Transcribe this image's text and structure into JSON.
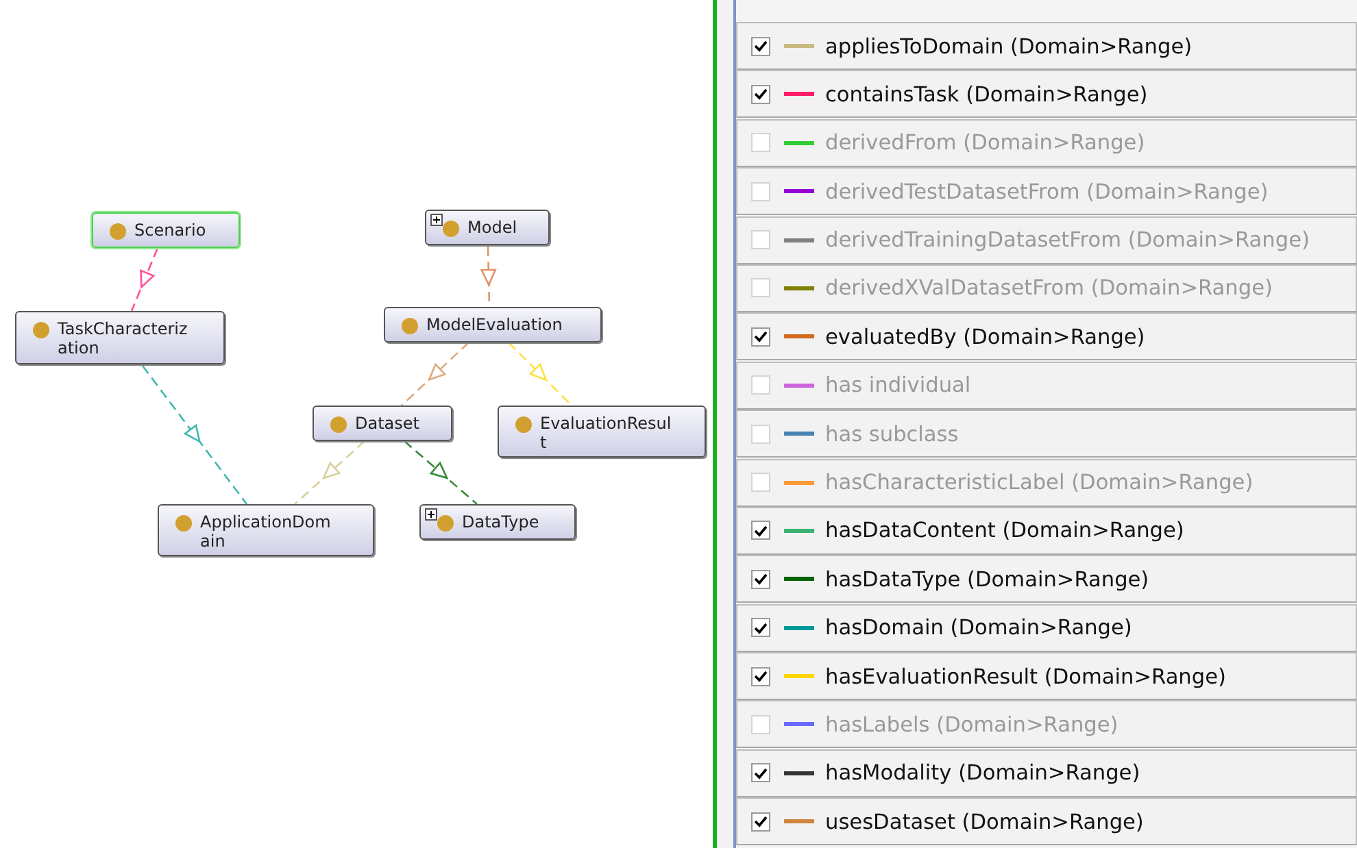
{
  "diagram": {
    "nodes": [
      {
        "label": "Scenario",
        "expandable": false,
        "selected": true
      },
      {
        "label": "TaskCharacterization",
        "expandable": false,
        "selected": false
      },
      {
        "label": "Model",
        "expandable": true,
        "selected": false
      },
      {
        "label": "ModelEvaluation",
        "expandable": false,
        "selected": false
      },
      {
        "label": "Dataset",
        "expandable": false,
        "selected": false
      },
      {
        "label": "EvaluationResult",
        "expandable": false,
        "selected": false
      },
      {
        "label": "ApplicationDomain",
        "expandable": false,
        "selected": false
      },
      {
        "label": "DataType",
        "expandable": true,
        "selected": false
      }
    ],
    "edges": [
      {
        "color": "#ff4f9a"
      },
      {
        "color": "#3fb7b0"
      },
      {
        "color": "#e0956a"
      },
      {
        "color": "#dcaa80"
      },
      {
        "color": "#ffe040"
      },
      {
        "color": "#d8d09a"
      },
      {
        "color": "#3a8a3a"
      }
    ]
  },
  "properties": [
    {
      "label": "appliesToDomain (Domain>Range)",
      "checked": true,
      "color": "#c8ba80"
    },
    {
      "label": "containsTask (Domain>Range)",
      "checked": true,
      "color": "#ff1a6a"
    },
    {
      "label": "derivedFrom (Domain>Range)",
      "checked": false,
      "color": "#33cc33"
    },
    {
      "label": "derivedTestDatasetFrom (Domain>Range)",
      "checked": false,
      "color": "#9400d3"
    },
    {
      "label": "derivedTrainingDatasetFrom (Domain>Range)",
      "checked": false,
      "color": "#808080"
    },
    {
      "label": "derivedXValDatasetFrom (Domain>Range)",
      "checked": false,
      "color": "#808000"
    },
    {
      "label": "evaluatedBy (Domain>Range)",
      "checked": true,
      "color": "#d2691e"
    },
    {
      "label": "has individual",
      "checked": false,
      "color": "#cc66dd"
    },
    {
      "label": "has subclass",
      "checked": false,
      "color": "#4682b4"
    },
    {
      "label": "hasCharacteristicLabel (Domain>Range)",
      "checked": false,
      "color": "#ff9933"
    },
    {
      "label": "hasDataContent (Domain>Range)",
      "checked": true,
      "color": "#3cb371"
    },
    {
      "label": "hasDataType (Domain>Range)",
      "checked": true,
      "color": "#006400"
    },
    {
      "label": "hasDomain (Domain>Range)",
      "checked": true,
      "color": "#009999"
    },
    {
      "label": "hasEvaluationResult (Domain>Range)",
      "checked": true,
      "color": "#ffd700"
    },
    {
      "label": "hasLabels (Domain>Range)",
      "checked": false,
      "color": "#6a6aff"
    },
    {
      "label": "hasModality (Domain>Range)",
      "checked": true,
      "color": "#333333"
    },
    {
      "label": "usesDataset (Domain>Range)",
      "checked": true,
      "color": "#cd853f"
    }
  ]
}
